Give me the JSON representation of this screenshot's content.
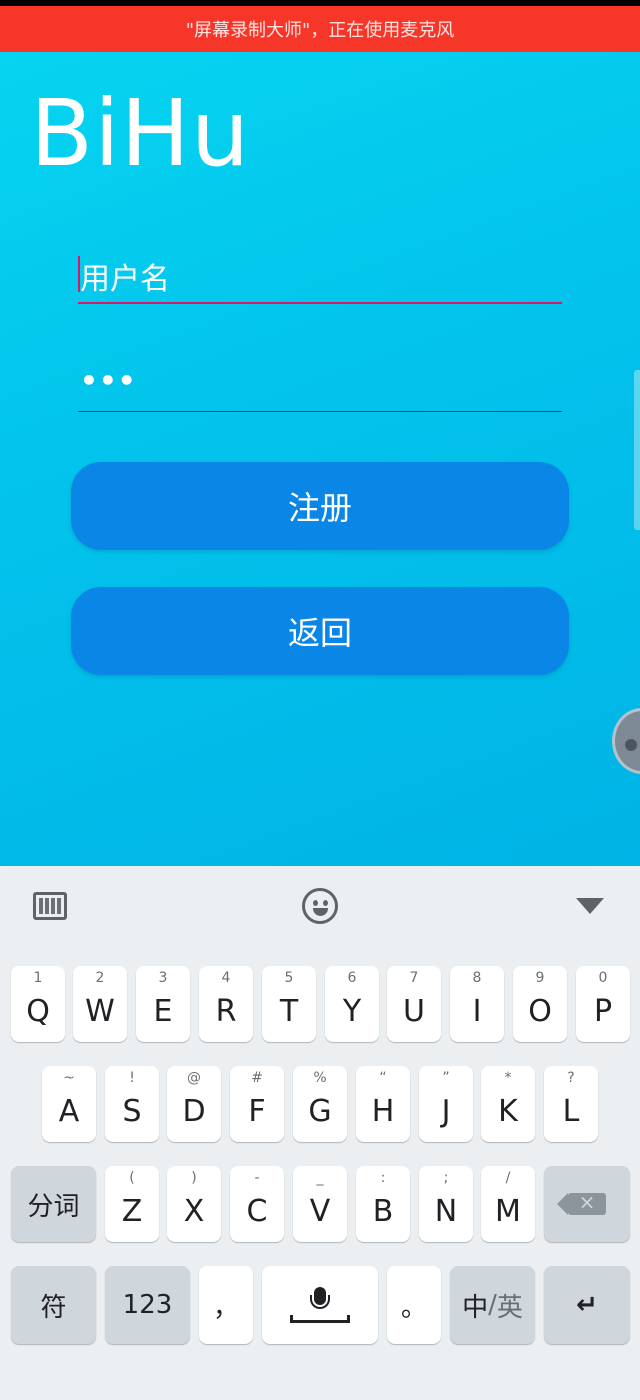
{
  "status_bar": {
    "recording_banner": "\"屏幕录制大师\"，正在使用麦克风"
  },
  "app": {
    "title": "BiHu",
    "username_field": {
      "value": "用户名"
    },
    "password_field": {
      "value": "•••"
    },
    "register_button": "注册",
    "back_button": "返回"
  },
  "keyboard": {
    "toolbar_icons": [
      "keyboard-icon",
      "emoji-icon",
      "hide-keyboard-icon"
    ],
    "row1": [
      {
        "hint": "1",
        "key": "Q"
      },
      {
        "hint": "2",
        "key": "W"
      },
      {
        "hint": "3",
        "key": "E"
      },
      {
        "hint": "4",
        "key": "R"
      },
      {
        "hint": "5",
        "key": "T"
      },
      {
        "hint": "6",
        "key": "Y"
      },
      {
        "hint": "7",
        "key": "U"
      },
      {
        "hint": "8",
        "key": "I"
      },
      {
        "hint": "9",
        "key": "O"
      },
      {
        "hint": "0",
        "key": "P"
      }
    ],
    "row2": [
      {
        "hint": "~",
        "key": "A"
      },
      {
        "hint": "!",
        "key": "S"
      },
      {
        "hint": "@",
        "key": "D"
      },
      {
        "hint": "#",
        "key": "F"
      },
      {
        "hint": "%",
        "key": "G"
      },
      {
        "hint": "“",
        "key": "H"
      },
      {
        "hint": "”",
        "key": "J"
      },
      {
        "hint": "*",
        "key": "K"
      },
      {
        "hint": "?",
        "key": "L"
      }
    ],
    "row3": {
      "left": "分词",
      "keys": [
        {
          "hint": "(",
          "key": "Z"
        },
        {
          "hint": ")",
          "key": "X"
        },
        {
          "hint": "-",
          "key": "C"
        },
        {
          "hint": "_",
          "key": "V"
        },
        {
          "hint": ":",
          "key": "B"
        },
        {
          "hint": ";",
          "key": "N"
        },
        {
          "hint": "/",
          "key": "M"
        }
      ]
    },
    "row4": {
      "symbols": "符",
      "numbers": "123",
      "comma": "，",
      "period": "。",
      "lang_cn": "中",
      "lang_sep": "/",
      "lang_en": "英"
    }
  }
}
